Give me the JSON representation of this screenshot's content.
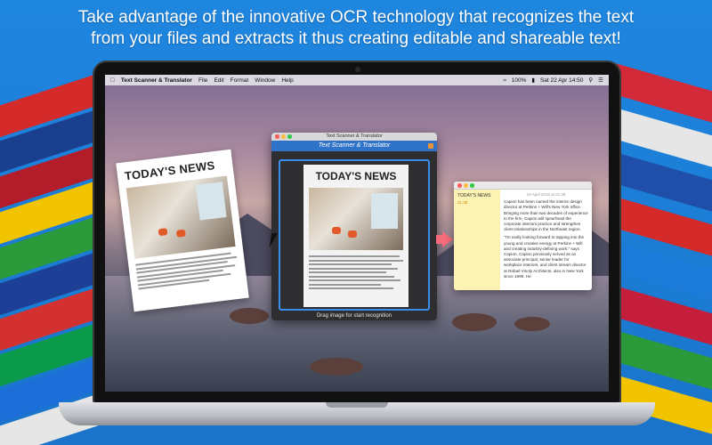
{
  "headline": {
    "line1": "Take advantage of the innovative OCR technology that recognizes the text",
    "line2": "from your files and extracts it thus creating editable and shareable text!"
  },
  "menubar": {
    "app_name": "Text Scanner & Translator",
    "items": [
      "File",
      "Edit",
      "Format",
      "Window",
      "Help"
    ],
    "battery": "100%",
    "clock": "Sat 22 Apr 14:50"
  },
  "newspaper": {
    "title": "TODAY'S NEWS"
  },
  "scanner_window": {
    "window_title": "Text Scanner & Translator",
    "header_title": "Text Scanner & Translator",
    "paper_title": "TODAY'S NEWS",
    "hint": "Drag image for start recognition"
  },
  "result_window": {
    "note_title": "TODAY'S NEWS",
    "note_time": "21:38",
    "date": "19 April 2016 at 21:38",
    "paragraph1": "Capion has been named the interior design director at Perkins + Will's New York office. Bringing more than two decades of experience to the firm, Capion will spearhead the corporate interiors practice and strengthen client relationships in the Northeast region.",
    "paragraph2": "\"I'm really looking forward to tapping into the young and creative energy at Perkins + Will and creating industry-defining work,\" says Capion. Capion previously served as an associate principal, senior leader for workplace interiors, and client stream director at Rafael Vinoly Architects, also in New York since 1999. He"
  },
  "colors": {
    "accent": "#3b8ef0",
    "header_blue": "#2f73c9",
    "arrow": "#f56b7a",
    "note_yellow": "#fbf2b4"
  }
}
